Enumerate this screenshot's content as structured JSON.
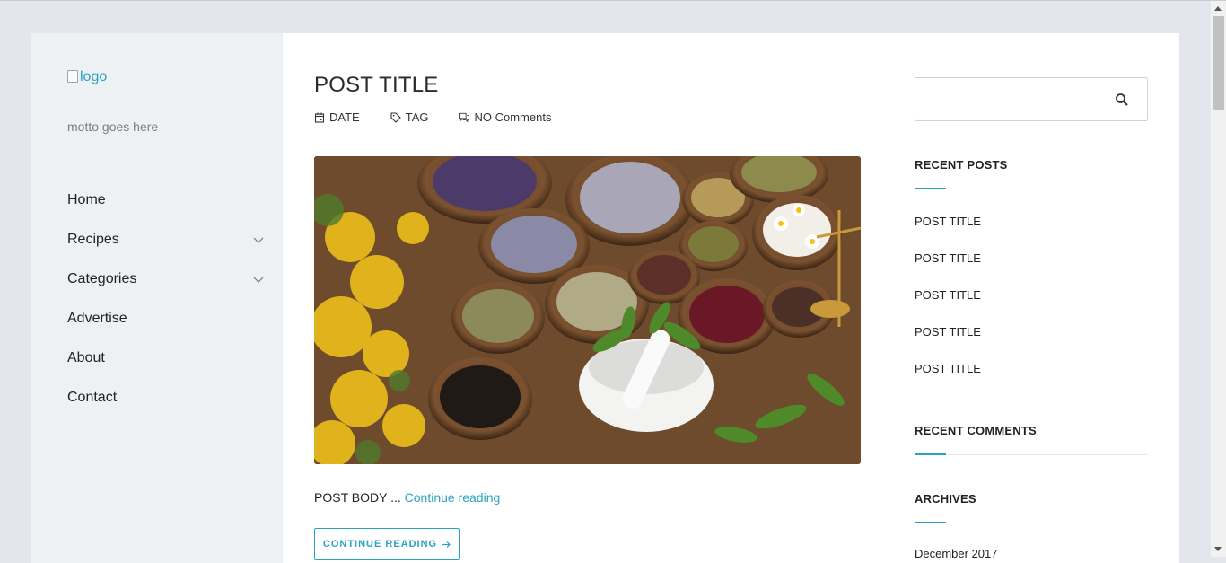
{
  "site": {
    "logo_alt": "logo",
    "motto": "motto goes here"
  },
  "nav": {
    "items": [
      {
        "label": "Home",
        "has_submenu": false
      },
      {
        "label": "Recipes",
        "has_submenu": true
      },
      {
        "label": "Categories",
        "has_submenu": true
      },
      {
        "label": "Advertise",
        "has_submenu": false
      },
      {
        "label": "About",
        "has_submenu": false
      },
      {
        "label": "Contact",
        "has_submenu": false
      }
    ]
  },
  "post": {
    "title": "POST TITLE",
    "meta": {
      "date": "DATE",
      "tag": "TAG",
      "comments": "NO Comments"
    },
    "body": "POST BODY ...",
    "continue_link": "Continue reading",
    "continue_button": "CONTINUE READING",
    "image_subject": "herbs and spices in wooden bowls with mortar and pestle"
  },
  "sidebar": {
    "search_placeholder": "",
    "recent_posts": {
      "title": "RECENT POSTS",
      "items": [
        "POST TITLE",
        "POST TITLE",
        "POST TITLE",
        "POST TITLE",
        "POST TITLE"
      ]
    },
    "recent_comments": {
      "title": "RECENT COMMENTS"
    },
    "archives": {
      "title": "ARCHIVES",
      "first_item": "December 2017"
    }
  },
  "colors": {
    "accent": "#2aa3c0",
    "background": "#e3e6ec",
    "sidebar_bg": "#eef1f4"
  }
}
